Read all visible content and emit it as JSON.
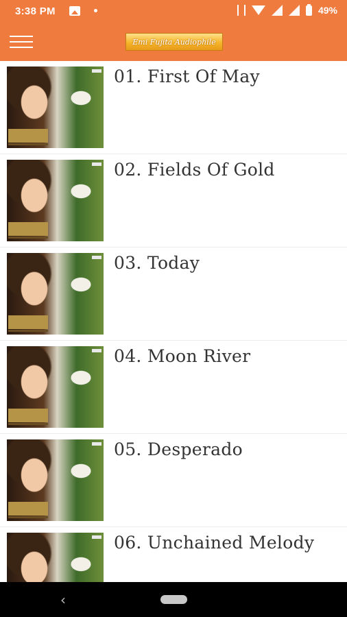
{
  "status_bar": {
    "time": "3:38 PM",
    "battery": "49%",
    "icons": [
      "image-icon",
      "notification-dot-icon",
      "vibrate-icon",
      "wifi-icon",
      "signal-icon",
      "signal-icon",
      "battery-icon"
    ]
  },
  "app_bar": {
    "menu_icon": "menu-icon",
    "logo_text": "Emi Fujita Audiophile",
    "color": "#f07b3f"
  },
  "tracks": [
    {
      "title": "01. First Of May"
    },
    {
      "title": "02. Fields Of Gold"
    },
    {
      "title": "03. Today"
    },
    {
      "title": "04. Moon River"
    },
    {
      "title": "05. Desperado"
    },
    {
      "title": "06. Unchained Melody"
    }
  ],
  "nav_bar": {
    "back_icon": "back-icon",
    "back_glyph": "‹",
    "home_icon": "home-pill-icon"
  }
}
